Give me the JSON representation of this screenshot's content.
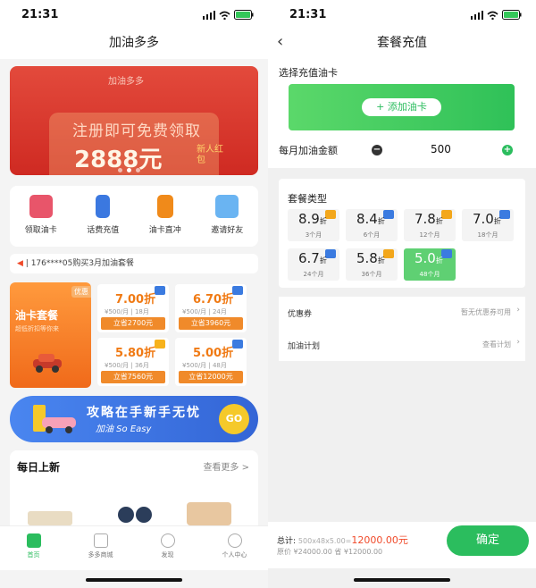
{
  "status": {
    "time": "21:31"
  },
  "left": {
    "title": "加油多多",
    "banner": {
      "logo": "加油多多",
      "line1": "注册即可免费领取",
      "line2": "2888元",
      "line3": "新人红包"
    },
    "quick": [
      {
        "label": "领取油卡",
        "icon": "card-icon",
        "color": "#e8556a"
      },
      {
        "label": "话费充值",
        "icon": "phone-icon",
        "color": "#3b78e0"
      },
      {
        "label": "油卡直冲",
        "icon": "fuel-pump-icon",
        "color": "#f08a1a"
      },
      {
        "label": "邀请好友",
        "icon": "envelope-icon",
        "color": "#6ab4f2"
      }
    ],
    "ticker": "| 176****05购买3月加油套餐",
    "package": {
      "title": "油卡套餐",
      "subtitle": "超低折扣等你来",
      "tag": "优惠"
    },
    "cards": [
      {
        "price": "7.00折",
        "sub": "¥500/月 | 18月",
        "save": "立省2700元",
        "badge": "blue"
      },
      {
        "price": "6.70折",
        "sub": "¥500/月 | 24月",
        "save": "立省3960元",
        "badge": "blue"
      },
      {
        "price": "5.80折",
        "sub": "¥500/月 | 36月",
        "save": "立省7560元",
        "badge": "yellow"
      },
      {
        "price": "5.00折",
        "sub": "¥500/月 | 48月",
        "save": "立省12000元",
        "badge": "blue"
      }
    ],
    "promo": {
      "line1": "攻略在手新手无忧",
      "line2": "加油 So Easy",
      "go": "GO"
    },
    "daily": {
      "title": "每日上新",
      "more": "查看更多 >"
    },
    "tabs": [
      "首页",
      "多多商城",
      "发现",
      "个人中心"
    ]
  },
  "right": {
    "title": "套餐充值",
    "select_label": "选择充值油卡",
    "add_card": "+ 添加油卡",
    "amount_label": "每月加油金额",
    "amount": "500",
    "plan_title": "套餐类型",
    "options": [
      {
        "d": "8.9",
        "u": "折",
        "s": "3个月",
        "badge": "yellow"
      },
      {
        "d": "8.4",
        "u": "折",
        "s": "6个月",
        "badge": "blue"
      },
      {
        "d": "7.8",
        "u": "折",
        "s": "12个月",
        "badge": "yellow"
      },
      {
        "d": "7.0",
        "u": "折",
        "s": "18个月",
        "badge": "blue"
      },
      {
        "d": "6.7",
        "u": "折",
        "s": "24个月",
        "badge": "blue"
      },
      {
        "d": "5.8",
        "u": "折",
        "s": "36个月",
        "badge": "yellow"
      },
      {
        "d": "5.0",
        "u": "折",
        "s": "48个月",
        "badge": "blue",
        "selected": true
      }
    ],
    "coupon_label": "优惠券",
    "coupon_value": "暂无优惠券可用",
    "plan_label": "加油计划",
    "plan_value": "查看计划",
    "total_label": "总计:",
    "total_formula": "500x48x5.00=",
    "total_price": "12000.00元",
    "original": "原价 ¥24000.00 省 ¥12000.00",
    "confirm": "确定"
  }
}
